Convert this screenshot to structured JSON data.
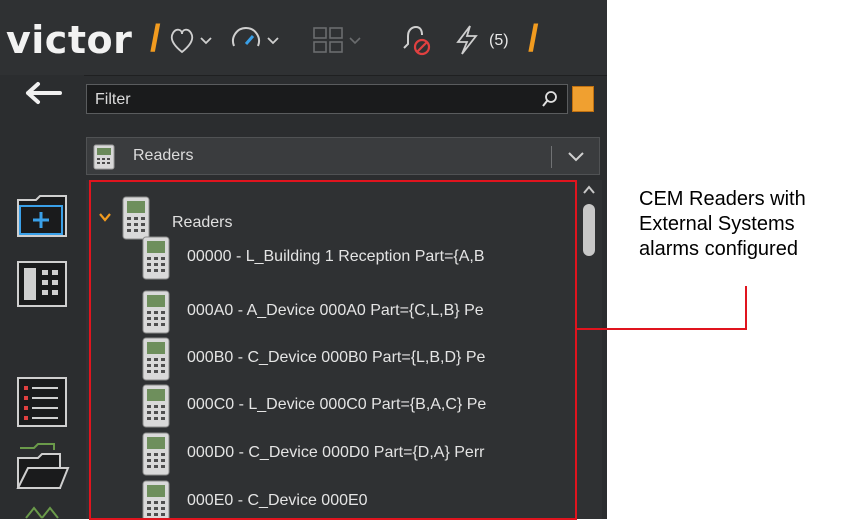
{
  "header": {
    "brand": "victor",
    "brand_slash": "/",
    "end_slash": "/",
    "alert_count": "(5)",
    "icons": [
      "heart-icon",
      "gauge-icon",
      "grid-icon",
      "alarm-bell-icon",
      "lightning-icon"
    ]
  },
  "filter": {
    "placeholder": "Filter"
  },
  "dropdown": {
    "selected": "Readers"
  },
  "tree": {
    "root_label": "Readers",
    "items": [
      {
        "label": "00000 - L_Building 1 Reception Part={A,B"
      },
      {
        "label": "000A0 - A_Device 000A0 Part={C,L,B} Pe"
      },
      {
        "label": "000B0 - C_Device 000B0 Part={L,B,D} Pe"
      },
      {
        "label": "000C0 - L_Device 000C0 Part={B,A,C} Pe"
      },
      {
        "label": "000D0 - C_Device 000D0 Part={D,A} Perr"
      },
      {
        "label": "000E0 - C_Device 000E0"
      }
    ]
  },
  "callout": {
    "lines": [
      "CEM Readers with",
      "External Systems",
      "alarms configured"
    ]
  },
  "colors": {
    "accent": "#f29b1f",
    "highlight": "#e0141e",
    "panel": "#2b2d2f"
  }
}
